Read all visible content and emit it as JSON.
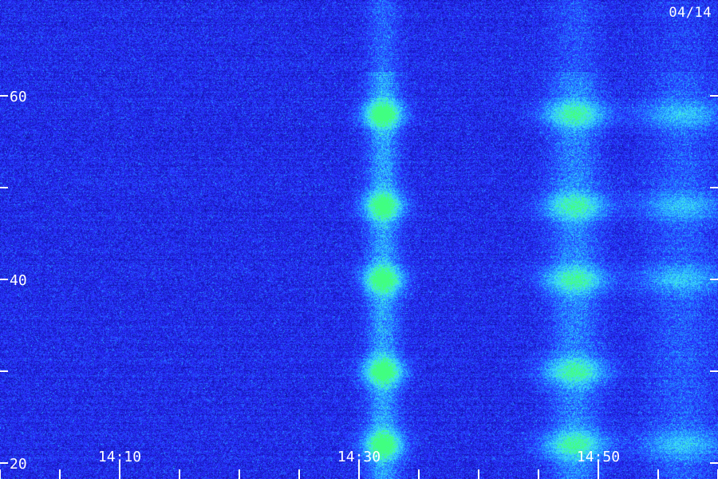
{
  "date_label": "04/14",
  "chart_data": {
    "type": "heatmap",
    "title": "",
    "xlabel": "",
    "ylabel": "",
    "x_ticks": [
      {
        "value": "14:10",
        "labeled": true
      },
      {
        "value": "14:30",
        "labeled": true
      },
      {
        "value": "14:50",
        "labeled": true
      }
    ],
    "x_minor_ticks_minutes": [
      14.0,
      14.25,
      14.5,
      14.75
    ],
    "y_ticks": [
      20,
      30,
      40,
      50,
      60
    ],
    "y_tick_labels": [
      "20",
      "40",
      "60"
    ],
    "ylim": [
      20,
      70
    ],
    "xlim_minutes_after_14:00": [
      0,
      60
    ],
    "colormap": [
      "#000033",
      "#1010a0",
      "#2a2aff",
      "#2090ff",
      "#40e0ff",
      "#40ff80"
    ],
    "features": [
      {
        "name": "signal-band-1",
        "x_time": "14:32",
        "intensity": "strong",
        "bright_spots_y": [
          58,
          48,
          40,
          30,
          22
        ]
      },
      {
        "name": "signal-band-2",
        "x_time": "14:48",
        "intensity": "medium",
        "bright_spots_y": [
          58,
          48,
          40,
          30,
          22
        ]
      },
      {
        "name": "signal-band-3",
        "x_time": "14:57",
        "intensity": "weak",
        "bright_spots_y": [
          58,
          48,
          40,
          22
        ]
      }
    ]
  }
}
